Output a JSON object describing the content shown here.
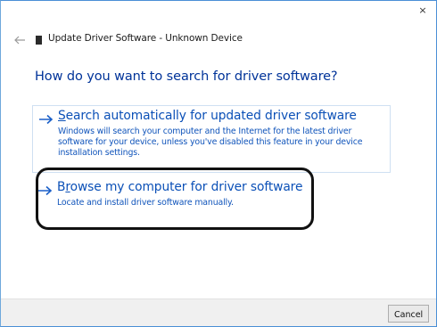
{
  "window": {
    "close_glyph": "×",
    "title": "Update Driver Software - Unknown Device"
  },
  "heading": "How do you want to search for driver software?",
  "options": [
    {
      "title_accel": "S",
      "title_rest": "earch automatically for updated driver software",
      "description": "Windows will search your computer and the Internet for the latest driver software for your device, unless you've disabled this feature in your device installation settings."
    },
    {
      "title_pre": "B",
      "title_accel": "r",
      "title_rest": "owse my computer for driver software",
      "description": "Locate and install driver software manually."
    }
  ],
  "footer": {
    "cancel_label": "Cancel"
  },
  "icons": {
    "back": "back-arrow-icon",
    "title": "driver-device-icon",
    "option_arrow": "right-arrow-icon"
  },
  "colors": {
    "heading": "#003399",
    "link": "#0b50b7",
    "accent_border": "#4a8fd6",
    "highlight_ring": "#111111"
  }
}
